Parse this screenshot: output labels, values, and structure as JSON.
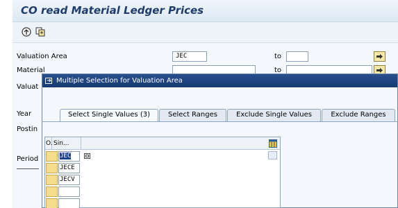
{
  "window": {
    "title": "CO read Material Ledger Prices"
  },
  "toolbar": {
    "buttons": [
      {
        "icon": "execute-clock-icon"
      },
      {
        "icon": "save-variant-icon"
      }
    ]
  },
  "form": {
    "rows": [
      {
        "label": "Valuation Area",
        "value": "JEC",
        "to_label": "to",
        "to_value": ""
      },
      {
        "label": "Material",
        "value": "",
        "to_label": "to",
        "to_value": ""
      },
      {
        "label": "Valuat",
        "value": ""
      },
      {
        "label": "Year"
      },
      {
        "label": "Postin"
      },
      {
        "label": "Period"
      }
    ]
  },
  "dialog": {
    "title": "Multiple Selection for Valuation Area",
    "tabs": [
      {
        "label": "Select Single Values (3)",
        "active": true
      },
      {
        "label": "Select Ranges",
        "active": false
      },
      {
        "label": "Exclude Single Values",
        "active": false
      },
      {
        "label": "Exclude Ranges",
        "active": false
      }
    ],
    "table": {
      "columns": [
        "O.",
        "Sin..."
      ],
      "rows": [
        {
          "value": "JEC",
          "selected": true
        },
        {
          "value": "JECE",
          "selected": false
        },
        {
          "value": "JECV",
          "selected": false
        },
        {
          "value": "",
          "selected": false
        },
        {
          "value": "",
          "selected": false
        }
      ]
    }
  },
  "colors": {
    "title_text": "#1f3c6a",
    "dialog_title_bg": "#173a73",
    "row_selector": "#f6dd8b",
    "selection": "#1c3f8e"
  }
}
